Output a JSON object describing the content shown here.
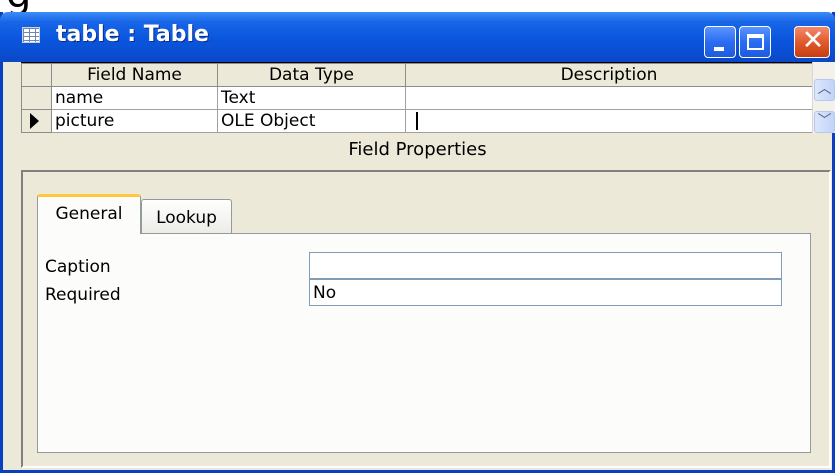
{
  "window": {
    "title": "table : Table",
    "controls": {
      "minimize": "minimize",
      "maximize": "maximize",
      "close": "close"
    }
  },
  "grid": {
    "columns": [
      "Field Name",
      "Data Type",
      "Description"
    ],
    "rows": [
      {
        "field_name": "name",
        "data_type": "Text",
        "description": ""
      },
      {
        "field_name": "picture",
        "data_type": "OLE Object",
        "description": ""
      }
    ],
    "current_row": 1
  },
  "field_properties": {
    "label": "Field Properties",
    "tabs": [
      {
        "label": "General",
        "selected": true
      },
      {
        "label": "Lookup",
        "selected": false
      }
    ],
    "properties": [
      {
        "label": "Caption",
        "value": ""
      },
      {
        "label": "Required",
        "value": "No"
      }
    ]
  },
  "colors": {
    "titlebar": "#0a55dd",
    "window_border": "#0a3fc2",
    "close_button": "#e25a2e",
    "tab_highlight": "#ffc83c",
    "face": "#ece9d8"
  },
  "icons": [
    "table-icon",
    "minimize-icon",
    "maximize-icon",
    "close-icon",
    "current-row-arrow-icon",
    "scroll-up-icon",
    "scroll-down-icon"
  ]
}
